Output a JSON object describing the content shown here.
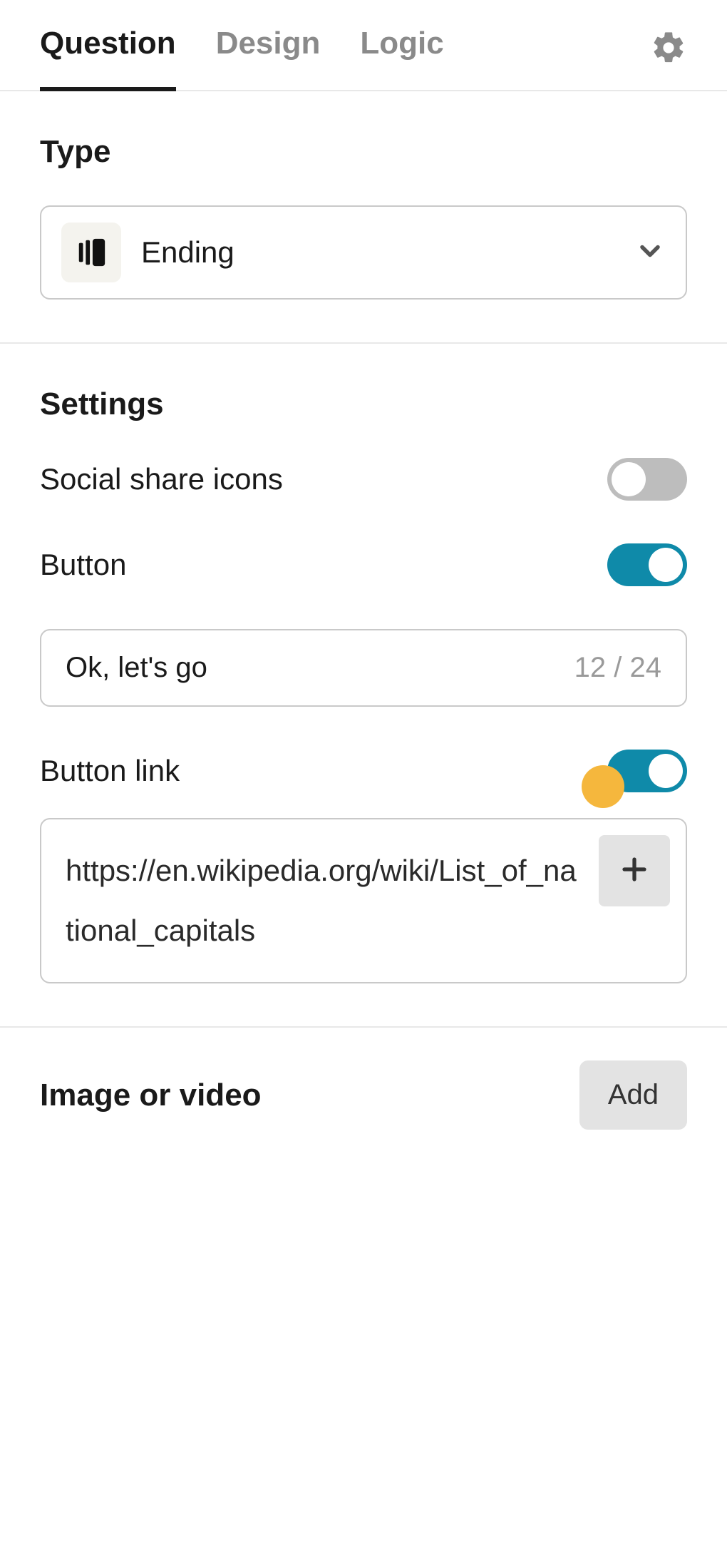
{
  "tabs": {
    "items": [
      {
        "label": "Question",
        "active": true
      },
      {
        "label": "Design",
        "active": false
      },
      {
        "label": "Logic",
        "active": false
      }
    ],
    "gear_icon": "gear"
  },
  "type": {
    "section_title": "Type",
    "icon": "ending-icon",
    "selected_label": "Ending"
  },
  "settings": {
    "section_title": "Settings",
    "social_share": {
      "label": "Social share icons",
      "on": false
    },
    "button": {
      "label": "Button",
      "on": true,
      "text_value": "Ok, let's go",
      "char_counter": "12 / 24"
    },
    "button_link": {
      "label": "Button link",
      "on": true,
      "url": "https://en.wikipedia.org/wiki/List_of_national_capitals",
      "highlight_dot": true
    }
  },
  "media": {
    "section_title": "Image or video",
    "add_label": "Add"
  }
}
